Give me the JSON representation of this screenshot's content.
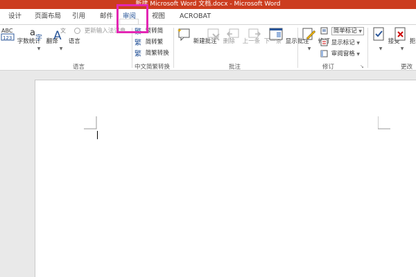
{
  "title": "新建 Microsoft Word 文档.docx - Microsoft Word",
  "tabs": [
    {
      "label": "设计"
    },
    {
      "label": "页面布局"
    },
    {
      "label": "引用"
    },
    {
      "label": "邮件"
    },
    {
      "label": "审阅"
    },
    {
      "label": "视图"
    },
    {
      "label": "ACROBAT"
    }
  ],
  "ribbon": {
    "word_count": "字数统计",
    "translate": "翻译",
    "language": "语言",
    "update_input_method": "更新输入法词典",
    "language_group": "语言",
    "to_traditional": "繁转简",
    "to_simplified": "简转繁",
    "simp_trad_convert": "简繁转换",
    "chinese_convert_group": "中文简繁转换",
    "new_comment": "新建批注",
    "delete": "删除",
    "previous": "上一条",
    "next": "下一条",
    "show_comments": "显示批注",
    "comments_group": "批注",
    "track_changes": "修订",
    "simple_markup": "简单标记",
    "show_markup": "显示标记",
    "reviewing_pane": "审阅窗格",
    "tracking_group": "修订",
    "accept": "接受",
    "reject": "拒绝",
    "changes_group": "更改"
  },
  "colors": {
    "titlebar": "#cc3d1f",
    "highlight": "#e327b4",
    "active_tab_text": "#2b579a"
  }
}
